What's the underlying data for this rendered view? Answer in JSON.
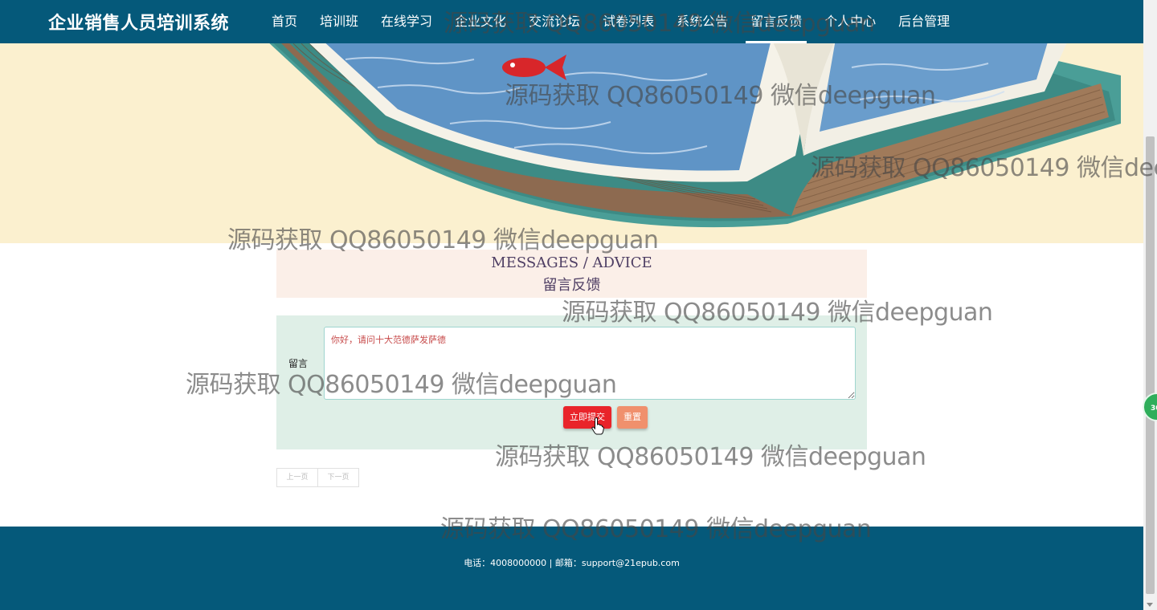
{
  "nav": {
    "brand": "企业销售人员培训系统",
    "items": [
      {
        "label": "首页"
      },
      {
        "label": "培训班"
      },
      {
        "label": "在线学习"
      },
      {
        "label": "企业文化"
      },
      {
        "label": "交流论坛"
      },
      {
        "label": "试卷列表"
      },
      {
        "label": "系统公告"
      },
      {
        "label": "留言反馈",
        "active": true
      },
      {
        "label": "个人中心"
      },
      {
        "label": "后台管理"
      }
    ]
  },
  "section": {
    "title_en": "MESSAGES / ADVICE",
    "title_zh": "留言反馈"
  },
  "form": {
    "label": "留言",
    "message_value": "你好，请问十大范德萨发萨德",
    "submit_label": "立即提交",
    "reset_label": "重置"
  },
  "pager": {
    "prev_label": "上一页",
    "next_label": "下一页"
  },
  "footer": {
    "contact": "电话：4008000000 | 邮箱：support@21epub.com"
  },
  "float_badge": "30",
  "watermark": {
    "text": "源码获取 QQ86050149 微信deepguan"
  },
  "colors": {
    "nav_bg": "#05597a",
    "banner_bg": "#fbf0cf",
    "form_bg": "#dfefe7",
    "submit": "#e9242a",
    "reset": "#f0906d"
  }
}
